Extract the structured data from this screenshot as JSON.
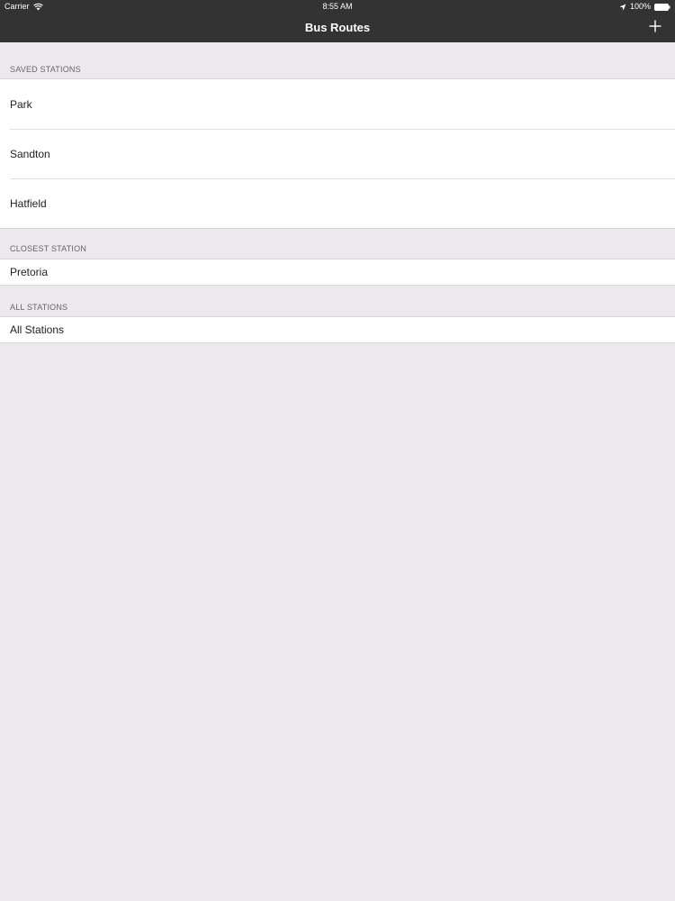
{
  "status_bar": {
    "carrier": "Carrier",
    "time": "8:55 AM",
    "battery": "100%",
    "icons": [
      "wifi-icon",
      "location-icon",
      "battery-icon"
    ]
  },
  "nav": {
    "title": "Bus Routes",
    "add_icon": "plus-icon"
  },
  "sections": {
    "saved": {
      "header": "SAVED STATIONS",
      "items": [
        "Park",
        "Sandton",
        "Hatfield"
      ]
    },
    "closest": {
      "header": "CLOSEST STATION",
      "items": [
        "Pretoria"
      ]
    },
    "all": {
      "header": "ALL STATIONS",
      "items": [
        "All Stations"
      ]
    }
  },
  "colors": {
    "nav_background": "#333333",
    "page_background": "#ebe9ec",
    "cell_background": "#ffffff"
  }
}
